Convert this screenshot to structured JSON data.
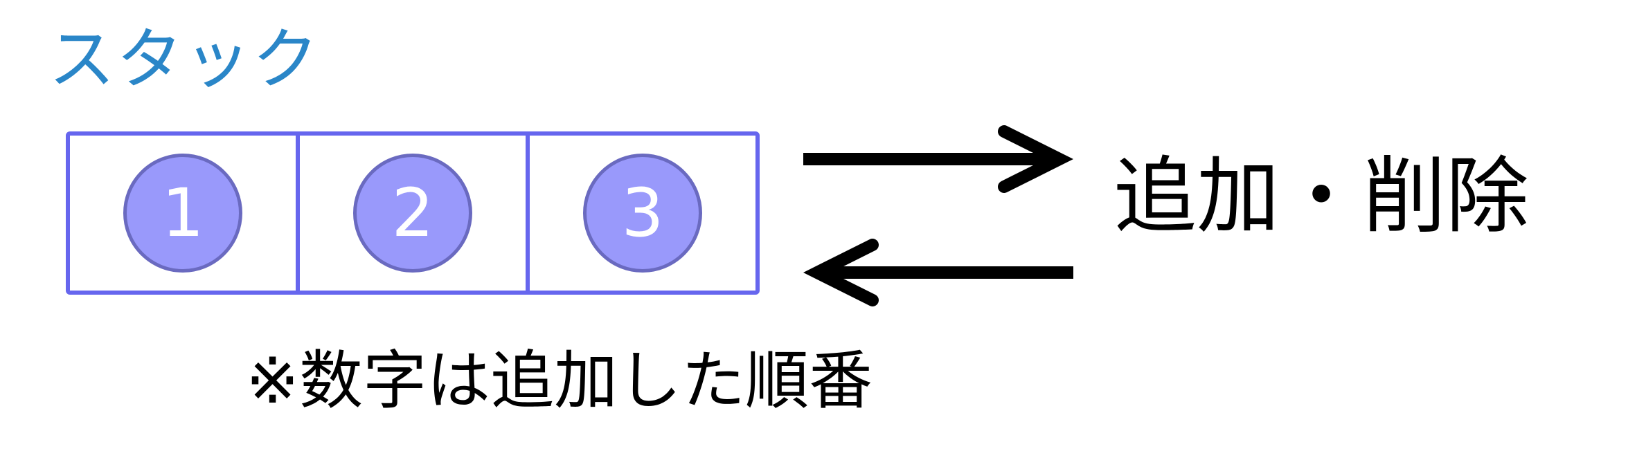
{
  "title": "スタック",
  "stack_items": [
    "1",
    "2",
    "3"
  ],
  "operation_label": "追加・削除",
  "note": "※数字は追加した順番",
  "colors": {
    "title": "#2a86c8",
    "box_border": "#6666ee",
    "circle_fill": "#9999fb",
    "circle_stroke": "#6a6ac0",
    "arrow": "#000000"
  },
  "icons": {
    "push_arrow": "right-arrow",
    "pop_arrow": "left-arrow"
  }
}
